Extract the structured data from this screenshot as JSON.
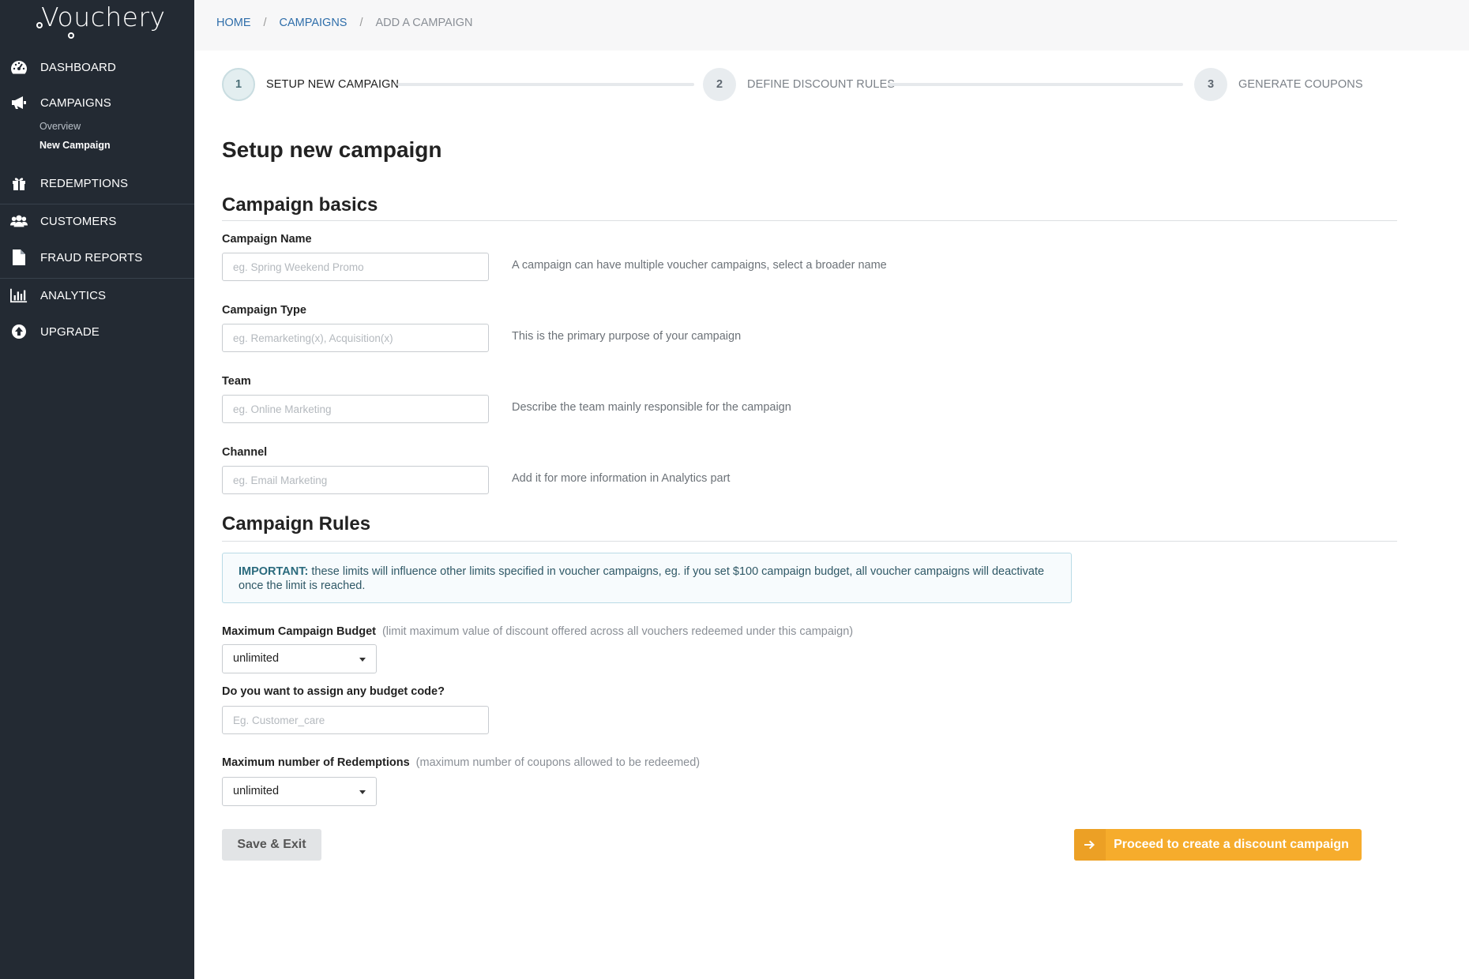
{
  "app": {
    "logo_text": "Vouchery"
  },
  "sidebar": {
    "items": [
      {
        "label": "DASHBOARD",
        "icon": "dashboard-icon"
      },
      {
        "label": "CAMPAIGNS",
        "icon": "megaphone-icon"
      },
      {
        "label": "REDEMPTIONS",
        "icon": "gift-icon"
      },
      {
        "label": "CUSTOMERS",
        "icon": "users-icon"
      },
      {
        "label": "FRAUD REPORTS",
        "icon": "file-icon"
      },
      {
        "label": "ANALYTICS",
        "icon": "bar-chart-icon"
      },
      {
        "label": "UPGRADE",
        "icon": "upgrade-icon"
      }
    ],
    "campaigns_sub": [
      {
        "label": "Overview",
        "active": false
      },
      {
        "label": "New Campaign",
        "active": true
      }
    ]
  },
  "breadcrumb": {
    "home": "HOME",
    "campaigns": "CAMPAIGNS",
    "current": "ADD A CAMPAIGN",
    "separator": "/"
  },
  "stepper": [
    {
      "number": "1",
      "label": "SETUP NEW CAMPAIGN",
      "active": true
    },
    {
      "number": "2",
      "label": "DEFINE DISCOUNT RULES",
      "active": false
    },
    {
      "number": "3",
      "label": "GENERATE COUPONS",
      "active": false
    }
  ],
  "page_title": "Setup new campaign",
  "basics": {
    "title": "Campaign basics",
    "fields": [
      {
        "label": "Campaign Name",
        "placeholder": "eg. Spring Weekend Promo",
        "value": "",
        "help": "A campaign can have multiple voucher campaigns, select a broader name"
      },
      {
        "label": "Campaign Type",
        "placeholder": "eg. Remarketing(x), Acquisition(x)",
        "value": "",
        "help": "This is the primary purpose of your campaign"
      },
      {
        "label": "Team",
        "placeholder": "eg. Online Marketing",
        "value": "",
        "help": "Describe the team mainly responsible for the campaign"
      },
      {
        "label": "Channel",
        "placeholder": "eg. Email Marketing",
        "value": "",
        "help": "Add it for more information in Analytics part"
      }
    ]
  },
  "rules": {
    "title": "Campaign Rules",
    "alert_strong": "IMPORTANT:",
    "alert_text": " these limits will influence other limits specified in voucher campaigns, eg. if you set $100 campaign budget, all voucher campaigns will deactivate once the limit is reached.",
    "budget": {
      "label": "Maximum Campaign Budget",
      "note": "(limit maximum value of discount offered across all vouchers redeemed under this campaign)",
      "value": "unlimited"
    },
    "budget_code": {
      "label": "Do you want to assign any budget code?",
      "placeholder": "Eg. Customer_care",
      "value": ""
    },
    "redemptions": {
      "label": "Maximum number of Redemptions",
      "note": "(maximum number of coupons allowed to be redeemed)",
      "value": "unlimited"
    }
  },
  "actions": {
    "save_label": "Save & Exit",
    "proceed_label": "Proceed to create a discount campaign",
    "proceed_icon": "arrow-right-icon"
  },
  "colors": {
    "sidebar": "#232a33",
    "link": "#2f6eaa",
    "accent": "#f6ac2c",
    "alert_border": "#b9dbe6"
  }
}
